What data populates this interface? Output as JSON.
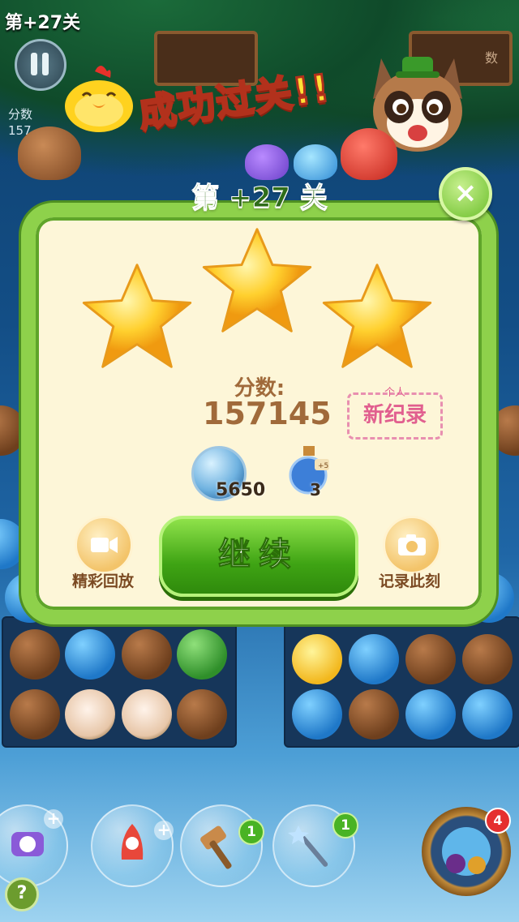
{
  "hud": {
    "level_text": "第+27关",
    "score_label": "分数",
    "score_partial": "157",
    "sign_text": "数"
  },
  "banner": {
    "text": "成功过关!!"
  },
  "panel": {
    "title": "第 +27 关",
    "close_symbol": "×",
    "stars_earned": 3,
    "stars_total": 3,
    "score_label": "分数:",
    "score_value": "157145",
    "record_small": "个人",
    "record_main": "新纪录",
    "coin_value": "5650",
    "potion_value": "3",
    "potion_tag": "+5",
    "continue_label": "继续",
    "replay_label": "精彩回放",
    "snapshot_label": "记录此刻"
  },
  "boosters": [
    {
      "name": "swap",
      "count": "+"
    },
    {
      "name": "rocket",
      "count": "+"
    },
    {
      "name": "hammer",
      "count": "1"
    },
    {
      "name": "magic-wand",
      "count": "1"
    }
  ],
  "boss_badge": "4",
  "help_symbol": "?",
  "colors": {
    "panel_border": "#8ed14b",
    "panel_bg": "#fdf6d8",
    "continue_green": "#3fa414",
    "score_brown": "#a06a3a",
    "record_pink": "#e15f8f"
  }
}
